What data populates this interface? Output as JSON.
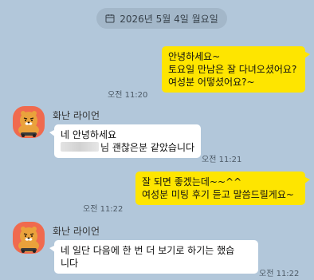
{
  "chat": {
    "date_divider": "2026년 5월 4일 월요일",
    "messages": [
      {
        "sender": "me",
        "lines": [
          "안녕하세요~",
          "토요일 만남은 잘 다녀오셨어요?",
          "여성분 어떻셨어요?~"
        ],
        "time": "오전 11:20"
      },
      {
        "sender": "화난 라이언",
        "lines": [
          "네 안녕하세요",
          "님 괜찮은분 같았습니다"
        ],
        "time": "오전 11:21"
      },
      {
        "sender": "me",
        "lines": [
          "잘 되면 좋겠는데~~^^",
          "여성분 미팅 후기 듣고 말씀드릴게요~"
        ],
        "time": "오전 11:22"
      },
      {
        "sender": "화난 라이언",
        "lines": [
          "네 일단 다음에 한 번 더 보기로 하기는 했습",
          "니다"
        ],
        "time": "오전 11:22"
      }
    ]
  },
  "colors": {
    "background": "#b2c7da",
    "my_bubble": "#fee500",
    "their_bubble": "#ffffff",
    "avatar": "#f06a4e"
  }
}
